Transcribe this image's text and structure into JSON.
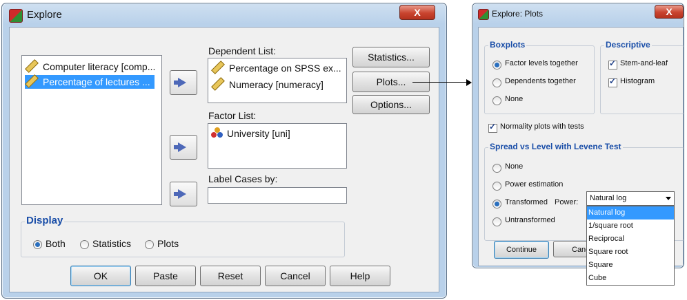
{
  "explore": {
    "title": "Explore",
    "close": "X",
    "variables": [
      {
        "label": "Computer literacy [comp...",
        "selected": false
      },
      {
        "label": "Percentage of lectures ...",
        "selected": true
      }
    ],
    "dependent_label": "Dependent List:",
    "dependent_items": [
      "Percentage on SPSS ex...",
      "Numeracy [numeracy]"
    ],
    "factor_label": "Factor List:",
    "factor_items": [
      "University [uni]"
    ],
    "label_cases_label": "Label Cases by:",
    "side_buttons": {
      "statistics": "Statistics...",
      "plots": "Plots...",
      "options": "Options..."
    },
    "display": {
      "title": "Display",
      "options": [
        {
          "label": "Both",
          "checked": true
        },
        {
          "label": "Statistics",
          "checked": false
        },
        {
          "label": "Plots",
          "checked": false
        }
      ]
    },
    "buttons": {
      "ok": "OK",
      "paste": "Paste",
      "reset": "Reset",
      "cancel": "Cancel",
      "help": "Help"
    }
  },
  "plots": {
    "title": "Explore: Plots",
    "close": "X",
    "boxplots": {
      "title": "Boxplots",
      "options": [
        {
          "label": "Factor levels together",
          "checked": true
        },
        {
          "label": "Dependents together",
          "checked": false
        },
        {
          "label": "None",
          "checked": false
        }
      ]
    },
    "descriptive": {
      "title": "Descriptive",
      "options": [
        {
          "label": "Stem-and-leaf",
          "checked": true
        },
        {
          "label": "Histogram",
          "checked": true
        }
      ]
    },
    "normality": {
      "label": "Normality plots with tests",
      "checked": true
    },
    "spread": {
      "title": "Spread vs Level with Levene Test",
      "options": [
        {
          "label": "None",
          "checked": false
        },
        {
          "label": "Power estimation",
          "checked": false
        },
        {
          "label": "Transformed",
          "checked": true
        },
        {
          "label": "Untransformed",
          "checked": false
        }
      ],
      "power_label": "Power:",
      "power_value": "Natural log",
      "dropdown_options": [
        "Natural log",
        "1/square root",
        "Reciprocal",
        "Square root",
        "Square",
        "Cube"
      ]
    },
    "buttons": {
      "continue": "Continue",
      "cancel": "Canc"
    }
  },
  "colors": {
    "selection": "#3399ff",
    "group_title": "#1a4ea8",
    "arrow": "#4d68b8"
  }
}
